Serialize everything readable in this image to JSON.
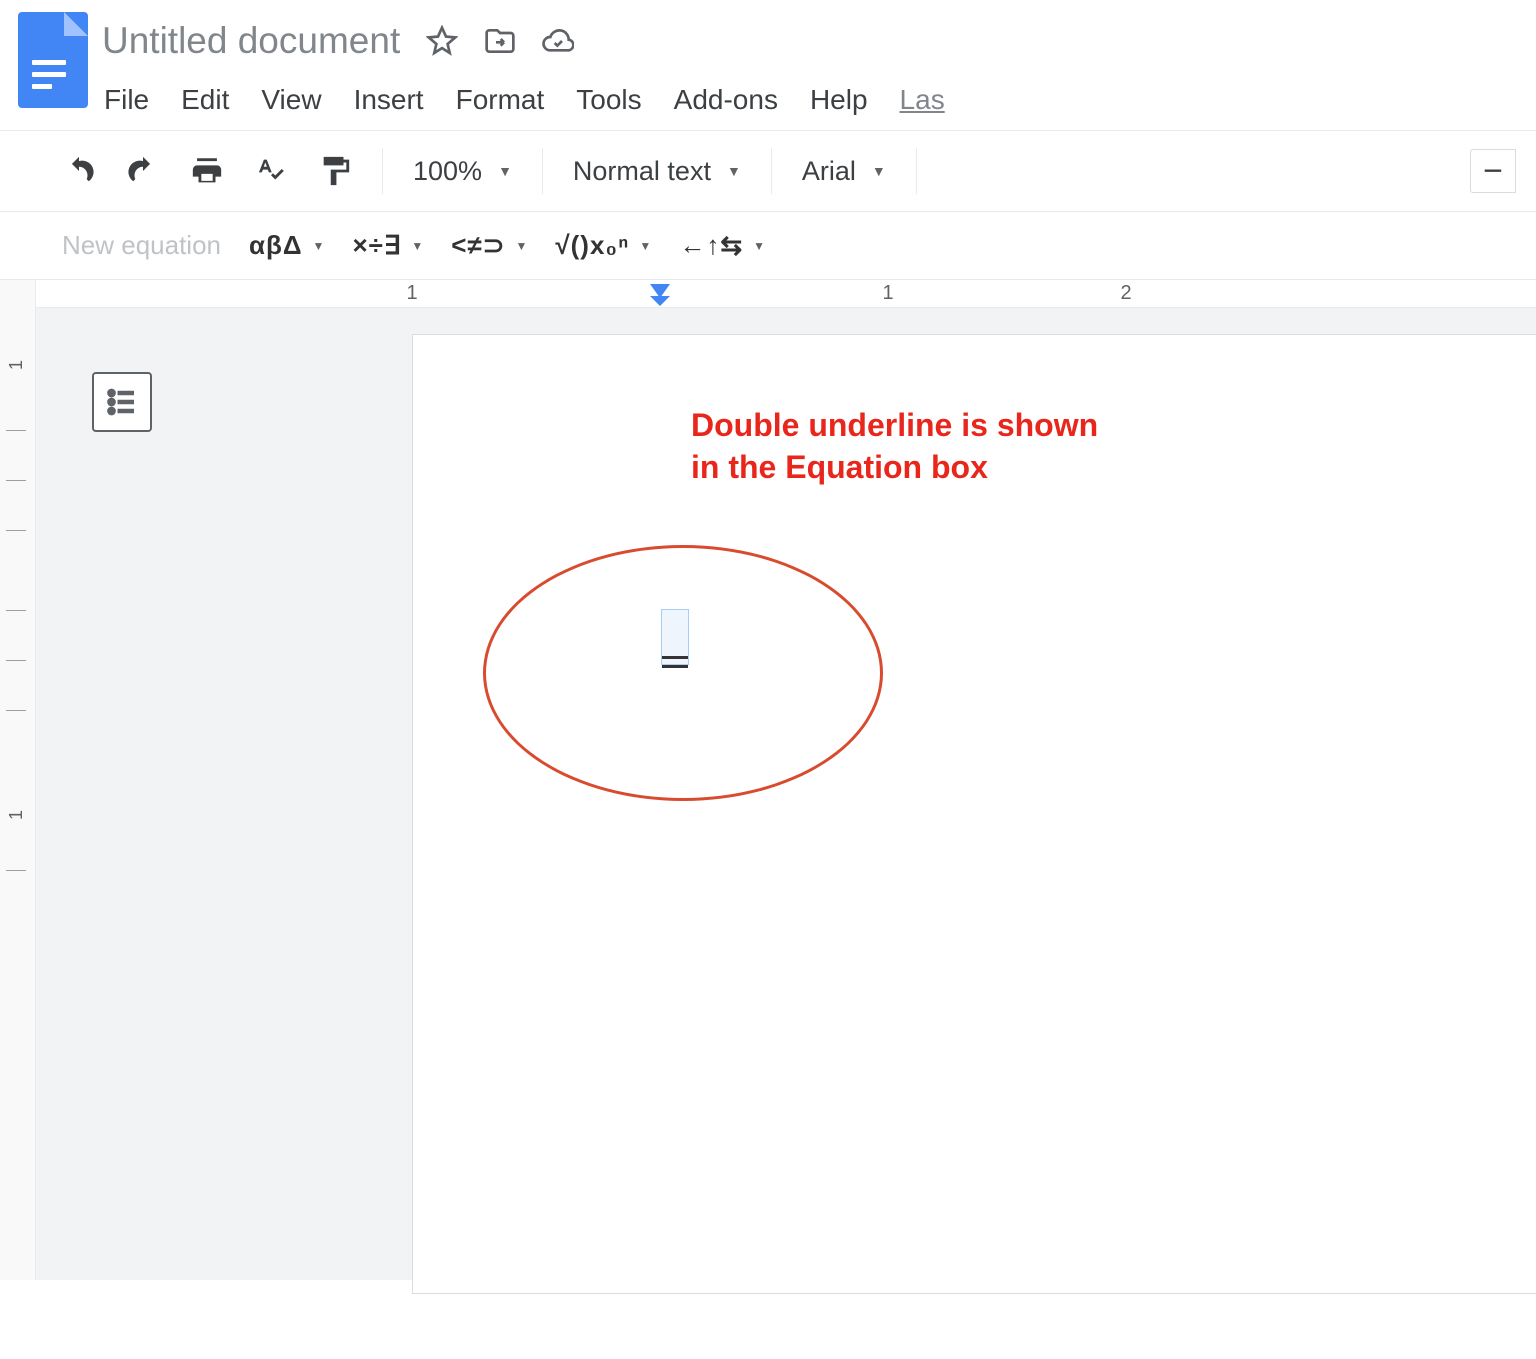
{
  "header": {
    "title": "Untitled document",
    "menu": [
      "File",
      "Edit",
      "View",
      "Insert",
      "Format",
      "Tools",
      "Add-ons",
      "Help"
    ],
    "menu_trailing": "Las"
  },
  "toolbar": {
    "zoom": "100%",
    "style": "Normal text",
    "font": "Arial",
    "minus": "−"
  },
  "eqnbar": {
    "new_label": "New equation",
    "greek": "αβΔ",
    "ops": "×÷∃",
    "rel": "<≠⊃",
    "math": "√()x₀ⁿ",
    "arrows": "←↑⇆"
  },
  "ruler": {
    "h_nums": [
      "1",
      "1",
      "2"
    ]
  },
  "annotation": "Double underline is shown in the Equation box"
}
